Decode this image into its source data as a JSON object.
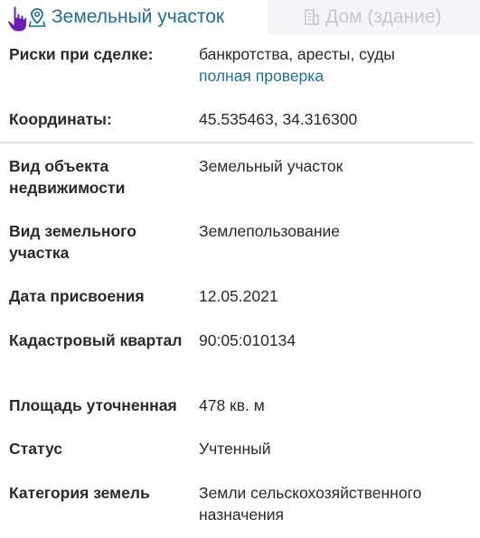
{
  "tabs": {
    "active_label": "Земельный участок",
    "inactive_label": "Дом (здание)"
  },
  "risks": {
    "label": "Риски при сделке:",
    "value": "банкротства, аресты, суды",
    "link": "полная проверка"
  },
  "coordinates": {
    "label": "Координаты:",
    "value": "45.535463, 34.316300"
  },
  "properties": [
    {
      "label": "Вид объекта недвижимости",
      "value": "Земельный участок"
    },
    {
      "label": "Вид земельного участка",
      "value": "Землепользование"
    },
    {
      "label": "Дата присвоения",
      "value": "12.05.2021"
    },
    {
      "label": "Кадастровый квартал",
      "value": "90:05:010134"
    },
    {
      "label": "Площадь уточненная",
      "value": "478 кв. м"
    },
    {
      "label": "Статус",
      "value": "Учтенный"
    },
    {
      "label": "Категория земель",
      "value": "Земли сельскохозяйственного назначения"
    }
  ],
  "colors": {
    "accent": "#1f6f9a",
    "inactive_tab_text": "#c4c8cc",
    "inactive_tab_bg": "#f4f5f6",
    "pointer": "#6a1fb5"
  },
  "icons": {
    "pointer": "hand-pointer-icon",
    "land": "map-pin-icon",
    "house": "building-icon"
  }
}
